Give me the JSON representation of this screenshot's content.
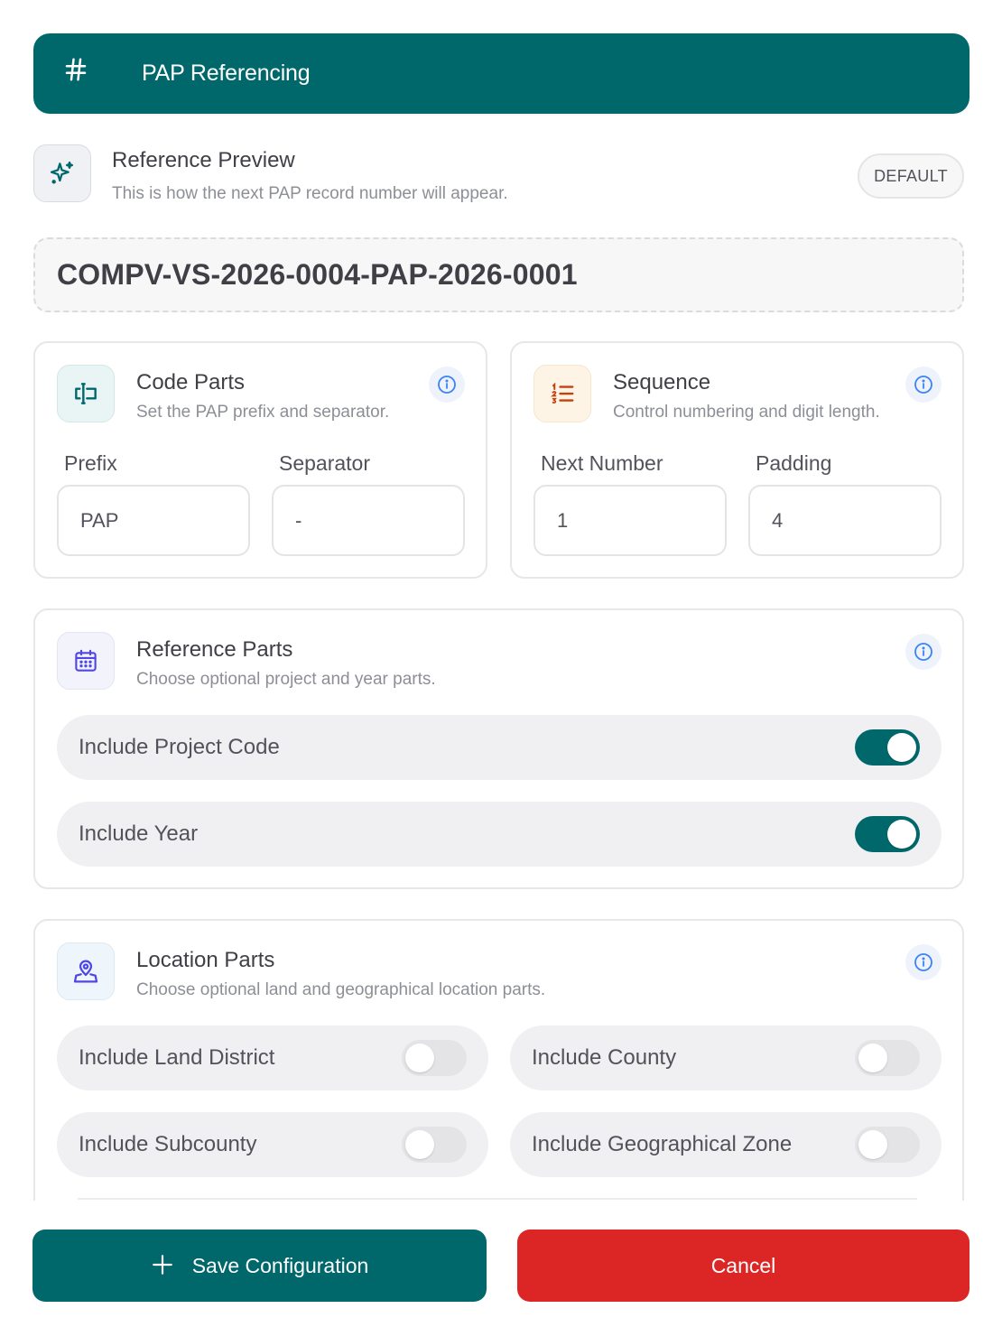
{
  "header": {
    "icon": "hash-icon",
    "title": "PAP Referencing",
    "bg_color": "#00686b"
  },
  "preview": {
    "icon": "sparkles-icon",
    "title": "Reference Preview",
    "subtitle": "This is how the next PAP record number will appear.",
    "badge": "DEFAULT",
    "value": "COMPV-VS-2026-0004-PAP-2026-0001"
  },
  "code_parts": {
    "icon": "text-cursor-icon",
    "title": "Code Parts",
    "subtitle": "Set the PAP prefix and separator.",
    "prefix": {
      "label": "Prefix",
      "value": "PAP"
    },
    "separator": {
      "label": "Separator",
      "value": "-"
    }
  },
  "sequence": {
    "icon": "ordered-list-icon",
    "title": "Sequence",
    "subtitle": "Control numbering and digit length.",
    "next_number": {
      "label": "Next Number",
      "value": "1"
    },
    "padding": {
      "label": "Padding",
      "value": "4"
    }
  },
  "reference_parts": {
    "icon": "calendar-icon",
    "title": "Reference Parts",
    "subtitle": "Choose optional project and year parts.",
    "toggles": [
      {
        "label": "Include Project Code",
        "on": true
      },
      {
        "label": "Include Year",
        "on": true
      }
    ]
  },
  "location_parts": {
    "icon": "map-pin-icon",
    "title": "Location Parts",
    "subtitle": "Choose optional land and geographical location parts.",
    "toggles": [
      {
        "label": "Include Land District",
        "on": false
      },
      {
        "label": "Include County",
        "on": false
      },
      {
        "label": "Include Subcounty",
        "on": false
      },
      {
        "label": "Include Geographical Zone",
        "on": false
      }
    ]
  },
  "footer": {
    "save_label": "Save Configuration",
    "save_icon": "plus-icon",
    "cancel_label": "Cancel",
    "save_color": "#00686b",
    "cancel_color": "#dc2626"
  }
}
